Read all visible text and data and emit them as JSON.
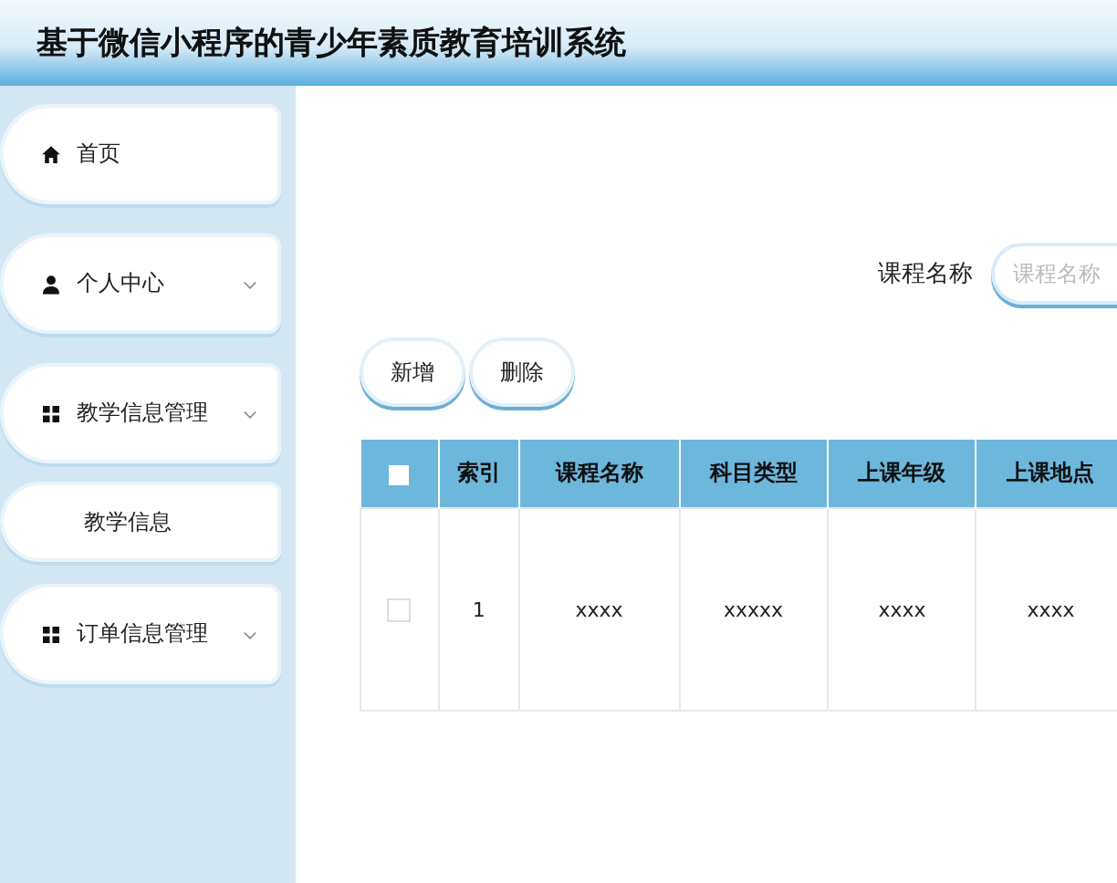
{
  "header": {
    "title": "基于微信小程序的青少年素质教育培训系统"
  },
  "sidebar": {
    "items": [
      {
        "label": "首页",
        "kind": "home",
        "collapsible": false
      },
      {
        "label": "个人中心",
        "kind": "user",
        "collapsible": true
      },
      {
        "label": "教学信息管理",
        "kind": "grid",
        "collapsible": true,
        "children": [
          {
            "label": "教学信息"
          }
        ]
      },
      {
        "label": "订单信息管理",
        "kind": "grid",
        "collapsible": true
      }
    ]
  },
  "search": {
    "label": "课程名称",
    "placeholder": "课程名称"
  },
  "buttons": [
    "新增",
    "删除"
  ],
  "table": {
    "select_all": {
      "checked": false
    },
    "columns": [
      "索引",
      "课程名称",
      "科目类型",
      "上课年级",
      "上课地点"
    ],
    "rows": [
      {
        "checked": false,
        "cells": [
          "1",
          "xxxx",
          "xxxxx",
          "xxxx",
          "xxxx"
        ]
      }
    ]
  }
}
